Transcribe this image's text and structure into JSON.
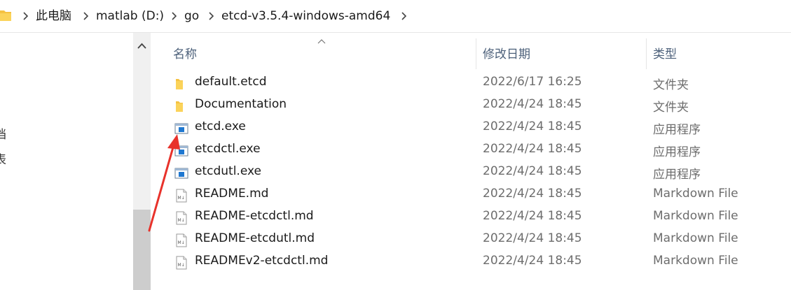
{
  "address_bar": {
    "crumbs": [
      "此电脑",
      "matlab (D:)",
      "go",
      "etcd-v3.5.4-windows-amd64"
    ]
  },
  "nav_pane": {
    "clipped_items": [
      "档",
      "表"
    ]
  },
  "columns": {
    "name": "名称",
    "modified": "修改日期",
    "type": "类型"
  },
  "files": [
    {
      "name": "default.etcd",
      "modified": "2022/6/17 16:25",
      "type": "文件夹",
      "icon": "folder-icon"
    },
    {
      "name": "Documentation",
      "modified": "2022/4/24 18:45",
      "type": "文件夹",
      "icon": "folder-icon"
    },
    {
      "name": "etcd.exe",
      "modified": "2022/4/24 18:45",
      "type": "应用程序",
      "icon": "exe-icon"
    },
    {
      "name": "etcdctl.exe",
      "modified": "2022/4/24 18:45",
      "type": "应用程序",
      "icon": "exe-icon"
    },
    {
      "name": "etcdutl.exe",
      "modified": "2022/4/24 18:45",
      "type": "应用程序",
      "icon": "exe-icon"
    },
    {
      "name": "README.md",
      "modified": "2022/4/24 18:45",
      "type": "Markdown File",
      "icon": "markdown-file-icon"
    },
    {
      "name": "README-etcdctl.md",
      "modified": "2022/4/24 18:45",
      "type": "Markdown File",
      "icon": "markdown-file-icon"
    },
    {
      "name": "README-etcdutl.md",
      "modified": "2022/4/24 18:45",
      "type": "Markdown File",
      "icon": "markdown-file-icon"
    },
    {
      "name": "READMEv2-etcdctl.md",
      "modified": "2022/4/24 18:45",
      "type": "Markdown File",
      "icon": "markdown-file-icon"
    }
  ],
  "colors": {
    "folder": "#f5c242",
    "exe_blue": "#1f78d1",
    "annotation_arrow": "#e8322b",
    "header_text": "#4c607a"
  }
}
